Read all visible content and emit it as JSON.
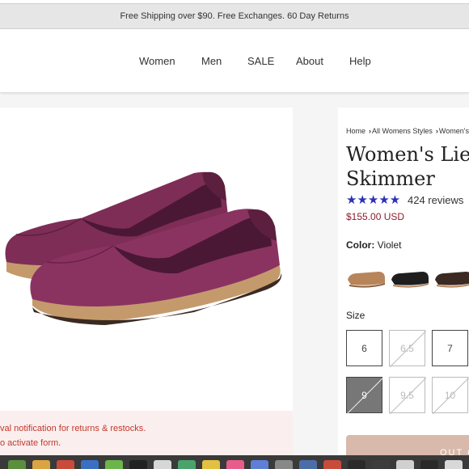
{
  "promo": {
    "text": "Free Shipping over $90. Free Exchanges. 60 Day Returns"
  },
  "nav": {
    "items": [
      "Women",
      "Men",
      "SALE",
      "About",
      "Help"
    ]
  },
  "breadcrumb": {
    "home": "Home",
    "category": "All Womens Styles",
    "current": "Women's"
  },
  "product": {
    "title_line1": "Women's Lies",
    "title_line2": "Skimmer",
    "rating": 4.5,
    "stars": "★★★★★",
    "reviews": "424 reviews",
    "price": "$155.00 USD",
    "color_label": "Color:",
    "color_value": "Violet",
    "color_main": "#7a2a52"
  },
  "sizes": {
    "label": "Size",
    "options": [
      {
        "value": "6",
        "available": true,
        "selected": false
      },
      {
        "value": "6.5",
        "available": false,
        "selected": false
      },
      {
        "value": "7",
        "available": true,
        "selected": false
      },
      {
        "value": "9",
        "available": false,
        "selected": true
      },
      {
        "value": "9.5",
        "available": false,
        "selected": false
      },
      {
        "value": "10",
        "available": false,
        "selected": false
      }
    ]
  },
  "notice": {
    "line1": "val notification for returns & restocks.",
    "line2": "o activate form."
  },
  "cart": {
    "label": "OUT OF STOCK"
  },
  "colors": {
    "accent_star": "#2b31b8",
    "price": "#8b1d2c",
    "notice_text": "#c0392b",
    "notice_bg": "#fbeeee",
    "button": "#d9b9ab"
  }
}
